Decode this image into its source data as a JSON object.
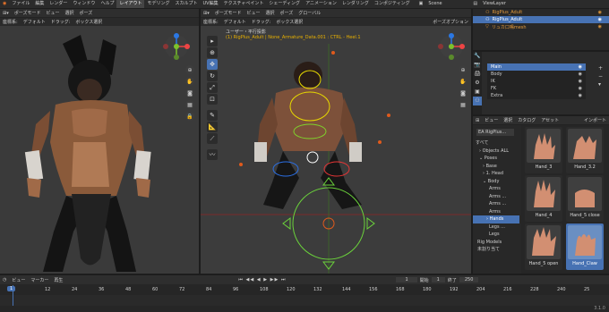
{
  "menubar": {
    "items": [
      "ファイル",
      "編集",
      "レンダー",
      "ウィンドウ",
      "ヘルプ"
    ],
    "workspaces": [
      "レイアウト",
      "モデリング",
      "スカルプト",
      "UV編集",
      "テクスチャペイント",
      "シェーディング",
      "アニメーション",
      "レンダリング",
      "コンポジティング"
    ],
    "active_workspace": "レイアウト",
    "scene": "Scene",
    "view_layer": "ViewLayer"
  },
  "left_viewport": {
    "header": [
      "ポーズモード",
      "ビュー",
      "選択",
      "ポーズ"
    ],
    "header2": [
      "座標系:",
      "デフォルト",
      "ドラッグ:",
      "ボックス選択"
    ],
    "gizmo_labels": [
      "Z",
      "X",
      "Y"
    ]
  },
  "right_viewport": {
    "header": [
      "ポーズモード",
      "ビュー",
      "選択",
      "ポーズ"
    ],
    "orientation": "グローバル",
    "header2": [
      "座標系:",
      "デフォルト",
      "ドラッグ:",
      "ボックス選択"
    ],
    "options": "ポーズオプション",
    "view_title": "ユーザー・平行投影",
    "view_subtitle": "(1) RigPlus_Adult | None_Armature_Data.001 : CTRL - Heel.1"
  },
  "outliner": {
    "items": [
      "RigPlus_Adult",
      "RigPlus_Adult",
      "リュカ口鳴mesh"
    ],
    "selected": 1
  },
  "bone_collections": {
    "items": [
      "Main",
      "Body",
      "IK",
      "FK",
      "Extra"
    ],
    "selected": 0
  },
  "asset_browser": {
    "header": [
      "ビュー",
      "選択",
      "カタログ",
      "アセット"
    ],
    "import_label": "インポート",
    "library": "EA RigPlus...",
    "tree": [
      {
        "label": "すべて",
        "indent": 0
      },
      {
        "label": "Objects ALL",
        "indent": 1
      },
      {
        "label": "Poses",
        "indent": 1
      },
      {
        "label": "Base",
        "indent": 2
      },
      {
        "label": "1. Head",
        "indent": 2
      },
      {
        "label": "Body",
        "indent": 2
      },
      {
        "label": "Arms",
        "indent": 3
      },
      {
        "label": "Arms ...",
        "indent": 3
      },
      {
        "label": "Arms ...",
        "indent": 3
      },
      {
        "label": "Arms",
        "indent": 3
      },
      {
        "label": "Hands",
        "indent": 3
      },
      {
        "label": "Legs ...",
        "indent": 3
      },
      {
        "label": "Legs",
        "indent": 3
      },
      {
        "label": "Rig Models",
        "indent": 1
      },
      {
        "label": "未割り当て",
        "indent": 1
      }
    ],
    "tree_selected": 10,
    "assets": [
      "Hand_3",
      "Hand_3.2",
      "Hand_4",
      "Hand_5 close",
      "Hand_5 open",
      "Hand_Claw"
    ],
    "asset_selected": 5
  },
  "timeline": {
    "header": [
      "ビュー",
      "マーカー",
      "再生"
    ],
    "current_frame": "1",
    "start_label": "開始",
    "start": "1",
    "end_label": "終了",
    "end": "250",
    "ticks": [
      "1",
      "12",
      "24",
      "36",
      "48",
      "60",
      "72",
      "84",
      "96",
      "108",
      "120",
      "132",
      "144",
      "156",
      "168",
      "180",
      "192",
      "204",
      "216",
      "228",
      "240",
      "25"
    ],
    "version": "3.1.0"
  }
}
